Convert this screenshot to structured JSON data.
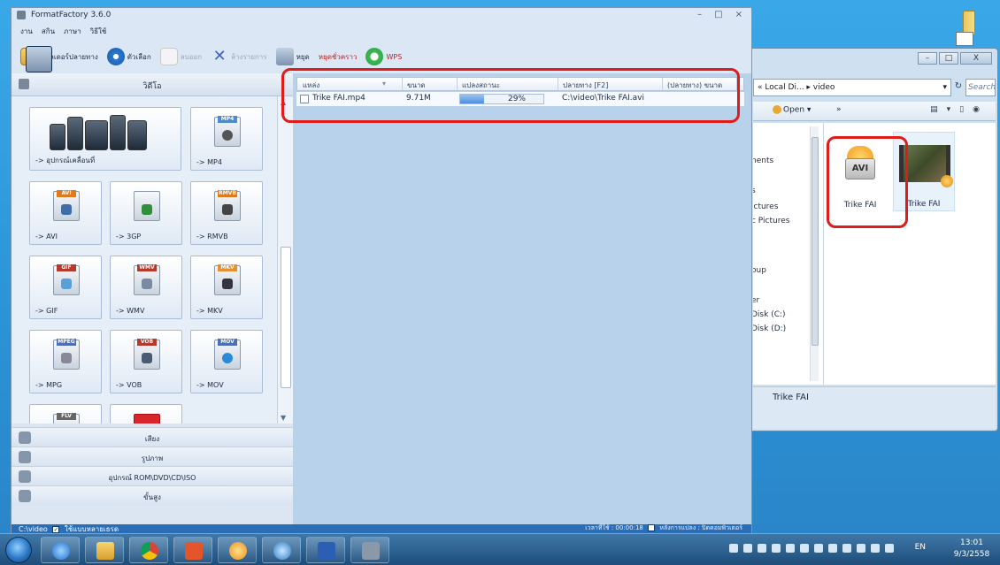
{
  "formatfactory": {
    "title": "FormatFactory 3.6.0",
    "menu": [
      "งาน",
      "สกิน",
      "ภาษา",
      "วิธีใช้"
    ],
    "toolbar": {
      "output_folder": "โฟลเดอร์ปลายทาง",
      "options": "ตัวเลือก",
      "remove": "ลบออก",
      "clear_list": "ล้างรายการ",
      "stop": "หยุด",
      "start": "หยุดชั่วคราว",
      "wps": "WPS"
    },
    "left_panel": {
      "header": "วิดีโอ",
      "tiles": [
        "-> อุปกรณ์เคลื่อนที่",
        "-> MP4",
        "-> AVI",
        "-> 3GP",
        "-> RMVB",
        "-> GIF",
        "-> WMV",
        "-> MKV",
        "-> MPG",
        "-> VOB",
        "-> MOV"
      ],
      "tile_tags": [
        "MP4",
        "AVI",
        "",
        "RMVB",
        "GIF",
        "WMV",
        "MKV",
        "MPEG",
        "VOB",
        "MOV",
        "FLV"
      ],
      "categories": [
        "เสียง",
        "รูปภาพ",
        "อุปกรณ์ ROM\\DVD\\CD\\ISO",
        "ขั้นสูง"
      ]
    },
    "table": {
      "headers": [
        "แหล่ง",
        "ขนาด",
        "แปลงสถานะ",
        "ปลายทาง [F2]",
        "(ปลายทาง) ขนาด"
      ],
      "rows": [
        {
          "source": "Trike FAI.mp4",
          "size": "9.71M",
          "progress": 0.29,
          "status": "29%",
          "output": "C:\\video\\Trike FAI.avi",
          "output_size": ""
        }
      ]
    },
    "status_bar": {
      "folder": "C:\\video",
      "multithread": "ใช้แบบหลายเธรด",
      "elapsed": "เวลาที่ใช้ : 00:00:18",
      "after_convert": "หลังการแปลง : ปิดคอมพิวเตอร์"
    },
    "window_controls": [
      "–",
      "□",
      "×"
    ]
  },
  "explorer": {
    "address": "« Local Di... ▸ video",
    "search_placeholder": "Search video",
    "toolbar_open": "Open ▾",
    "toolbar_more": "»",
    "nav_tree": [
      "nents",
      "s",
      "ictures",
      "c Pictures",
      "oup",
      "er",
      "Disk (C:)",
      "Disk (D:)"
    ],
    "files": [
      {
        "name": "Trike FAI",
        "icon": "avi-file-icon"
      },
      {
        "name": "Trike FAI",
        "icon": "video-thumbnail-icon"
      }
    ],
    "details_name": "Trike FAI",
    "window_controls": [
      "–",
      "□",
      "X"
    ]
  },
  "taskbar": {
    "language": "EN",
    "time": "13:01",
    "date": "9/3/2558"
  },
  "colors": {
    "highlight_box": "#e11a1a",
    "progress_fill": "#4c8fe0",
    "desktop": "#2f9fe0"
  }
}
